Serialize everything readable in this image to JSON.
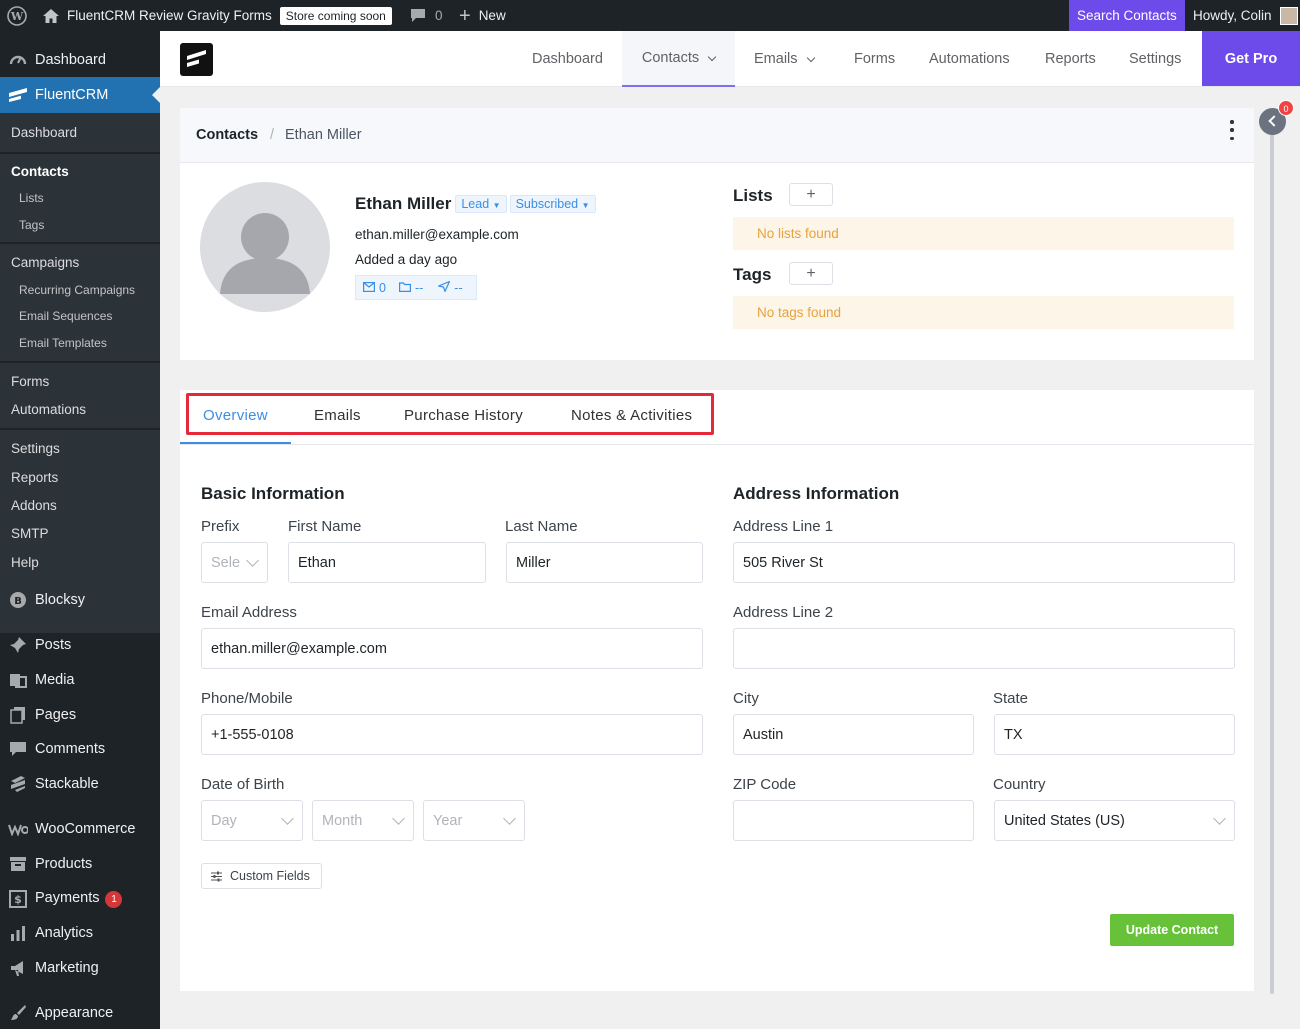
{
  "adminbar": {
    "site_name": "FluentCRM Review Gravity Forms",
    "store_badge": "Store coming soon",
    "comments_count": "0",
    "new_label": "New",
    "search_contacts": "Search Contacts",
    "howdy": "Howdy, Colin"
  },
  "sidebar": {
    "dashboard": "Dashboard",
    "fluentcrm": "FluentCRM",
    "sub": {
      "dashboard": "Dashboard",
      "contacts": "Contacts",
      "lists": "Lists",
      "tags": "Tags",
      "campaigns": "Campaigns",
      "recurring": "Recurring Campaigns",
      "sequences": "Email Sequences",
      "templates": "Email Templates",
      "forms": "Forms",
      "automations": "Automations",
      "settings": "Settings",
      "reports": "Reports",
      "addons": "Addons",
      "smtp": "SMTP",
      "help": "Help"
    },
    "blocksy": "Blocksy",
    "posts": "Posts",
    "media": "Media",
    "pages": "Pages",
    "comments": "Comments",
    "stackable": "Stackable",
    "woocommerce": "WooCommerce",
    "products": "Products",
    "payments": "Payments",
    "payments_badge": "1",
    "analytics": "Analytics",
    "marketing": "Marketing",
    "appearance": "Appearance"
  },
  "topnav": {
    "dashboard": "Dashboard",
    "contacts": "Contacts",
    "emails": "Emails",
    "forms": "Forms",
    "automations": "Automations",
    "reports": "Reports",
    "settings": "Settings",
    "get_pro": "Get Pro"
  },
  "breadcrumb": {
    "root": "Contacts",
    "sep": "/",
    "current": "Ethan Miller"
  },
  "profile": {
    "name": "Ethan Miller",
    "type_pill": "Lead",
    "status_pill": "Subscribed",
    "email": "ethan.miller@example.com",
    "added": "Added a day ago",
    "email_count": "0",
    "lists_stat": "--",
    "sent_stat": "--",
    "lists_title": "Lists",
    "no_lists": "No lists found",
    "tags_title": "Tags",
    "no_tags": "No tags found"
  },
  "tabs": {
    "overview": "Overview",
    "emails": "Emails",
    "purchase_history": "Purchase History",
    "notes": "Notes & Activities"
  },
  "basic": {
    "title": "Basic Information",
    "prefix_label": "Prefix",
    "prefix_value": "Sele",
    "first_name_label": "First Name",
    "first_name": "Ethan",
    "last_name_label": "Last Name",
    "last_name": "Miller",
    "email_label": "Email Address",
    "email": "ethan.miller@example.com",
    "phone_label": "Phone/Mobile",
    "phone": "+1-555-0108",
    "dob_label": "Date of Birth",
    "day": "Day",
    "month": "Month",
    "year": "Year",
    "custom_fields": "Custom Fields"
  },
  "address": {
    "title": "Address Information",
    "line1_label": "Address Line 1",
    "line1": "505 River St",
    "line2_label": "Address Line 2",
    "line2": "",
    "city_label": "City",
    "city": "Austin",
    "state_label": "State",
    "state": "TX",
    "zip_label": "ZIP Code",
    "zip": "",
    "country_label": "Country",
    "country": "United States (US)"
  },
  "update_button": "Update Contact",
  "help_badge": "0",
  "colors": {
    "accent_purple": "#6c4bea",
    "wp_blue": "#2271b1",
    "link_blue": "#3a8ee6",
    "success_green": "#67c23a",
    "highlight_red": "#e5293b"
  }
}
